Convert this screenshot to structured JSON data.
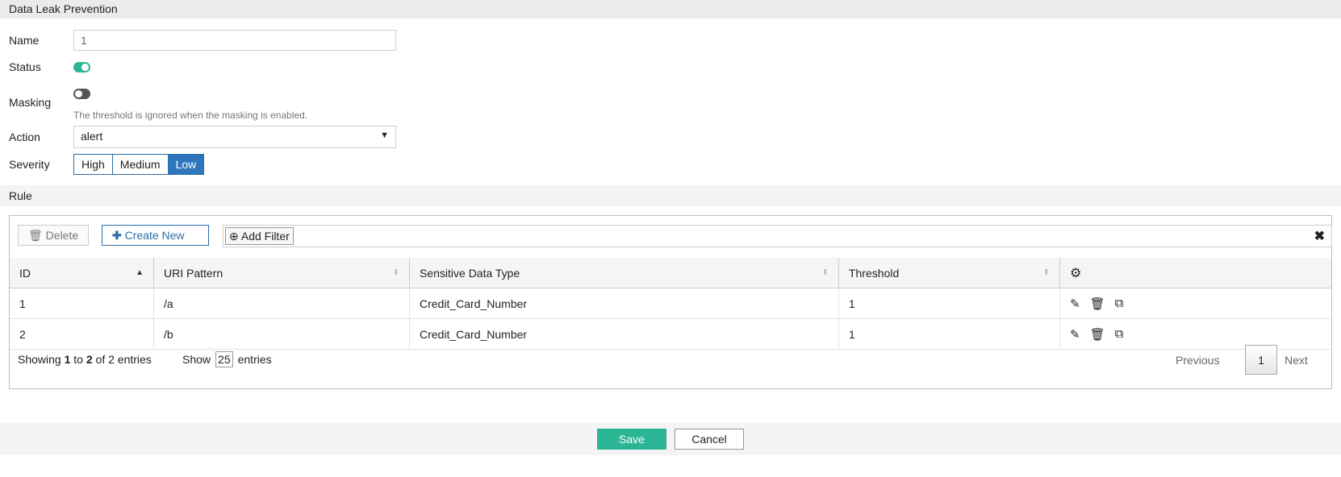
{
  "title": "Data Leak Prevention",
  "form": {
    "name_label": "Name",
    "name_value": "1",
    "status_label": "Status",
    "status_on": true,
    "masking_label": "Masking",
    "masking_on": false,
    "masking_hint": "The threshold is ignored when the masking is enabled.",
    "action_label": "Action",
    "action_value": "alert",
    "severity_label": "Severity",
    "severity_options": [
      "High",
      "Medium",
      "Low"
    ],
    "severity_selected": "Low"
  },
  "rule": {
    "section_label": "Rule",
    "toolbar": {
      "delete": "Delete",
      "create_new": "Create New",
      "add_filter": "Add Filter"
    },
    "columns": [
      "ID",
      "URI Pattern",
      "Sensitive Data Type",
      "Threshold"
    ],
    "rows": [
      {
        "id": "1",
        "uri": "/a",
        "type": "Credit_Card_Number",
        "threshold": "1"
      },
      {
        "id": "2",
        "uri": "/b",
        "type": "Credit_Card_Number",
        "threshold": "1"
      }
    ],
    "footer": {
      "showing_prefix": "Showing ",
      "from": "1",
      "to_word": " to ",
      "to": "2",
      "of_text": " of 2 entries",
      "show": "Show",
      "page_size": "25",
      "entries": "entries",
      "previous": "Previous",
      "page": "1",
      "next": "Next"
    }
  },
  "buttons": {
    "save": "Save",
    "cancel": "Cancel"
  },
  "colors": {
    "accent": "#2bb594",
    "blue": "#2e77bc"
  }
}
